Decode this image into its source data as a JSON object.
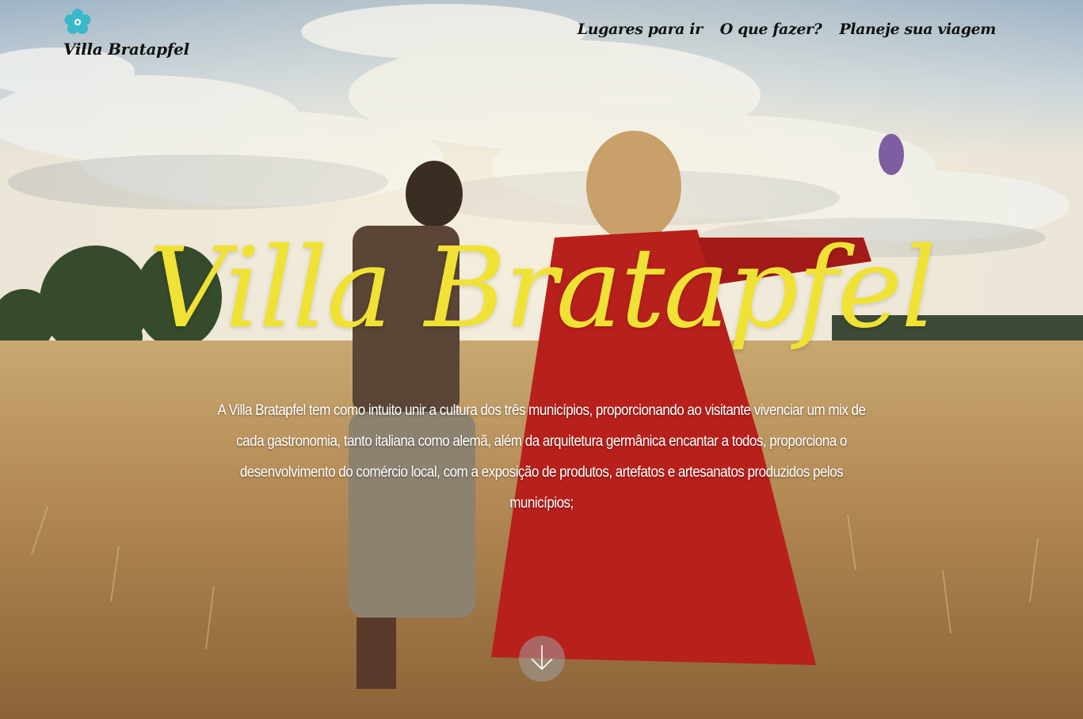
{
  "header": {
    "logo_text": "Villa Bratapfel",
    "logo_icon": "flower-icon",
    "nav": [
      {
        "label": "Lugares para ir"
      },
      {
        "label": "O que fazer?"
      },
      {
        "label": "Planeje sua viagem"
      }
    ]
  },
  "hero": {
    "title": "Villa Bratapfel",
    "description": "A Villa Bratapfel tem como intuito unir a cultura dos três municípios,  proporcionando ao visitante vivenciar um mix de cada gastronomia, tanto italiana como alemã, além da arquitetura germânica encantar a todos, proporciona o desenvolvimento do comércio local, com a exposição de produtos, artefatos e artesanatos produzidos pelos municípios;",
    "scroll_icon": "arrow-down-icon"
  },
  "colors": {
    "title": "#f0e234",
    "logo_icon": "#3bb8c8",
    "nav_text": "#111111",
    "description_text": "#ffffff"
  }
}
